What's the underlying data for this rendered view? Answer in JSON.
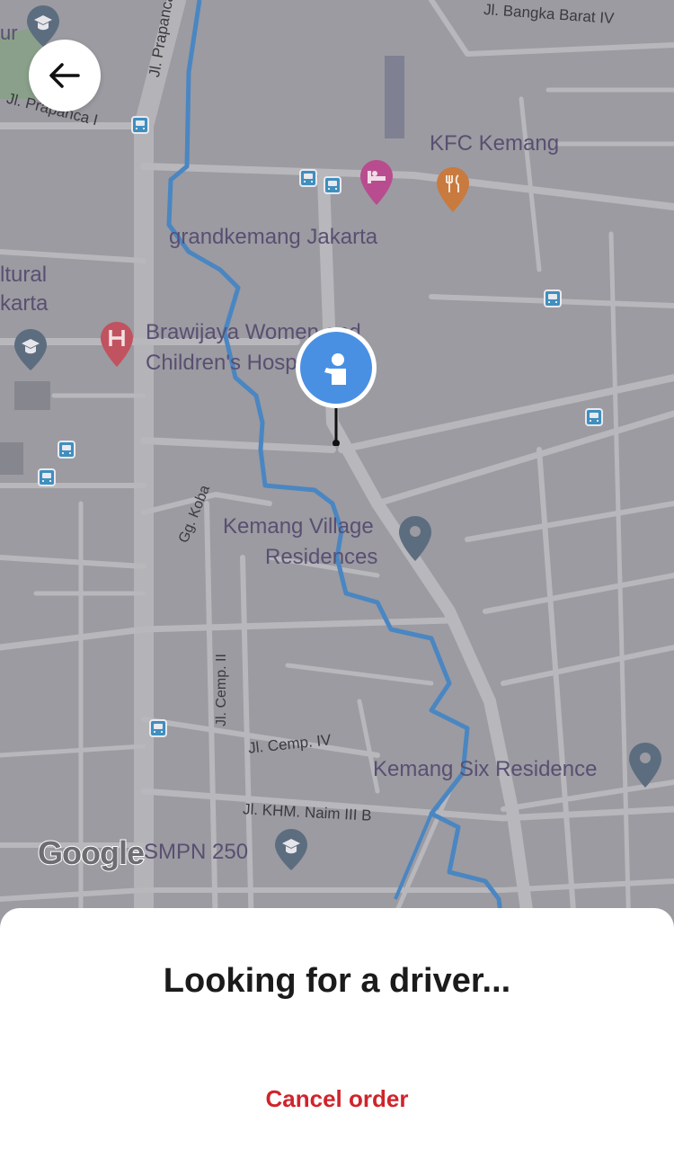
{
  "map": {
    "labels": {
      "bangka": "Jl. Bangka Barat IV",
      "kfc": "KFC Kemang",
      "grandkemang": "grandkemang Jakarta",
      "cultural_1": "ltural",
      "cultural_2": "karta",
      "brawijaya_1": "Brawijaya Women and",
      "brawijaya_2": "Children's Hospital",
      "kemang_village_1": "Kemang Village",
      "kemang_village_2": "Residences",
      "kemang_six": "Kemang Six Residence",
      "smpn": "SMPN 250",
      "ur": "ur"
    },
    "roads": {
      "prapanca_v": "Jl. Prapanca",
      "prapanca_i": "Jl. Prapanca I",
      "gg_koba": "Gg. Koba",
      "cemp_ii": "Jl. Cemp. II",
      "cemp_iv": "Jl. Cemp. IV",
      "khm_naim": "Jl. KHM. Naim III B"
    },
    "attribution": "Google"
  },
  "sheet": {
    "title": "Looking for a driver...",
    "cancel_label": "Cancel order"
  },
  "colors": {
    "cancel": "#d0242b",
    "river": "#4a86c2",
    "user_marker": "#4a90e2"
  }
}
